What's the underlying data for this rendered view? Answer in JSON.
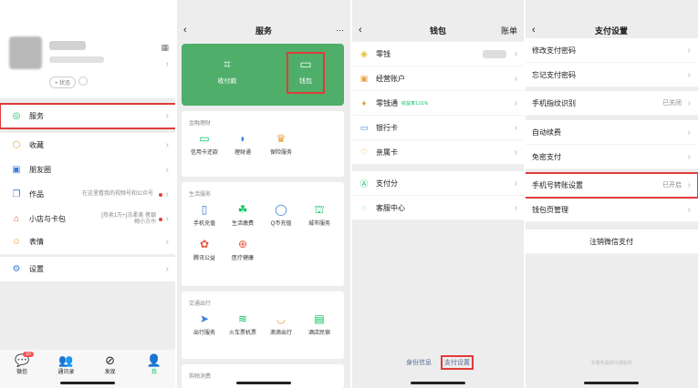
{
  "colors": {
    "accent": "#07c160",
    "highlight": "#e03b3b",
    "card_green": "#4eae6a",
    "link": "#576b95"
  },
  "panel1": {
    "status_pill": "+ 状态",
    "menu": [
      {
        "label": "服务",
        "icon": "services-icon"
      },
      {
        "label": "收藏",
        "icon": "favorites-icon"
      },
      {
        "label": "朋友圈",
        "icon": "moments-icon"
      },
      {
        "label": "作品",
        "icon": "works-icon",
        "sub": "在这里看我的视频号和公众号"
      },
      {
        "label": "小店与卡包",
        "icon": "shop-icon",
        "sub": "[热卖1万+]冻柔美 携银梅小方巾"
      },
      {
        "label": "表情",
        "icon": "sticker-icon"
      },
      {
        "label": "设置",
        "icon": "settings-icon"
      }
    ],
    "tabs": [
      {
        "label": "微信",
        "badge": "10"
      },
      {
        "label": "通讯录"
      },
      {
        "label": "发现"
      },
      {
        "label": "我"
      }
    ]
  },
  "panel2": {
    "title": "服务",
    "more": "···",
    "pay_label": "收付款",
    "wallet_label": "钱包",
    "sections": [
      {
        "title": "金融理财",
        "items": [
          "信用卡还款",
          "理财通",
          "保险服务"
        ]
      },
      {
        "title": "生活服务",
        "items": [
          "手机充值",
          "生活缴费",
          "Q币充值",
          "城市服务",
          "腾讯公益",
          "医疗健康"
        ]
      },
      {
        "title": "交通出行",
        "items": [
          "出行服务",
          "火车票机票",
          "滴滴出行",
          "酒店民宿"
        ]
      },
      {
        "title": "购物消费"
      }
    ]
  },
  "panel3": {
    "title": "钱包",
    "right": "账单",
    "group1": [
      {
        "label": "零钱"
      },
      {
        "label": "经营账户"
      },
      {
        "label": "零钱通",
        "tag": "收益率1.01%"
      },
      {
        "label": "银行卡"
      },
      {
        "label": "亲属卡"
      }
    ],
    "group2": [
      {
        "label": "支付分"
      },
      {
        "label": "客服中心"
      }
    ],
    "link_identity": "身份信息",
    "link_paysettings": "支付设置"
  },
  "panel4": {
    "title": "支付设置",
    "group1": [
      {
        "label": "修改支付密码"
      },
      {
        "label": "忘记支付密码"
      }
    ],
    "fingerprint": {
      "label": "手机指纹识别",
      "value": "已关闭"
    },
    "group3": [
      {
        "label": "自动续费"
      },
      {
        "label": "免密支付"
      }
    ],
    "phone_transfer": {
      "label": "手机号转账设置",
      "value": "已开启"
    },
    "wallet_page": {
      "label": "钱包页管理"
    },
    "cancel": "注销微信支付",
    "footer_note": "本服务由财付通提供"
  }
}
